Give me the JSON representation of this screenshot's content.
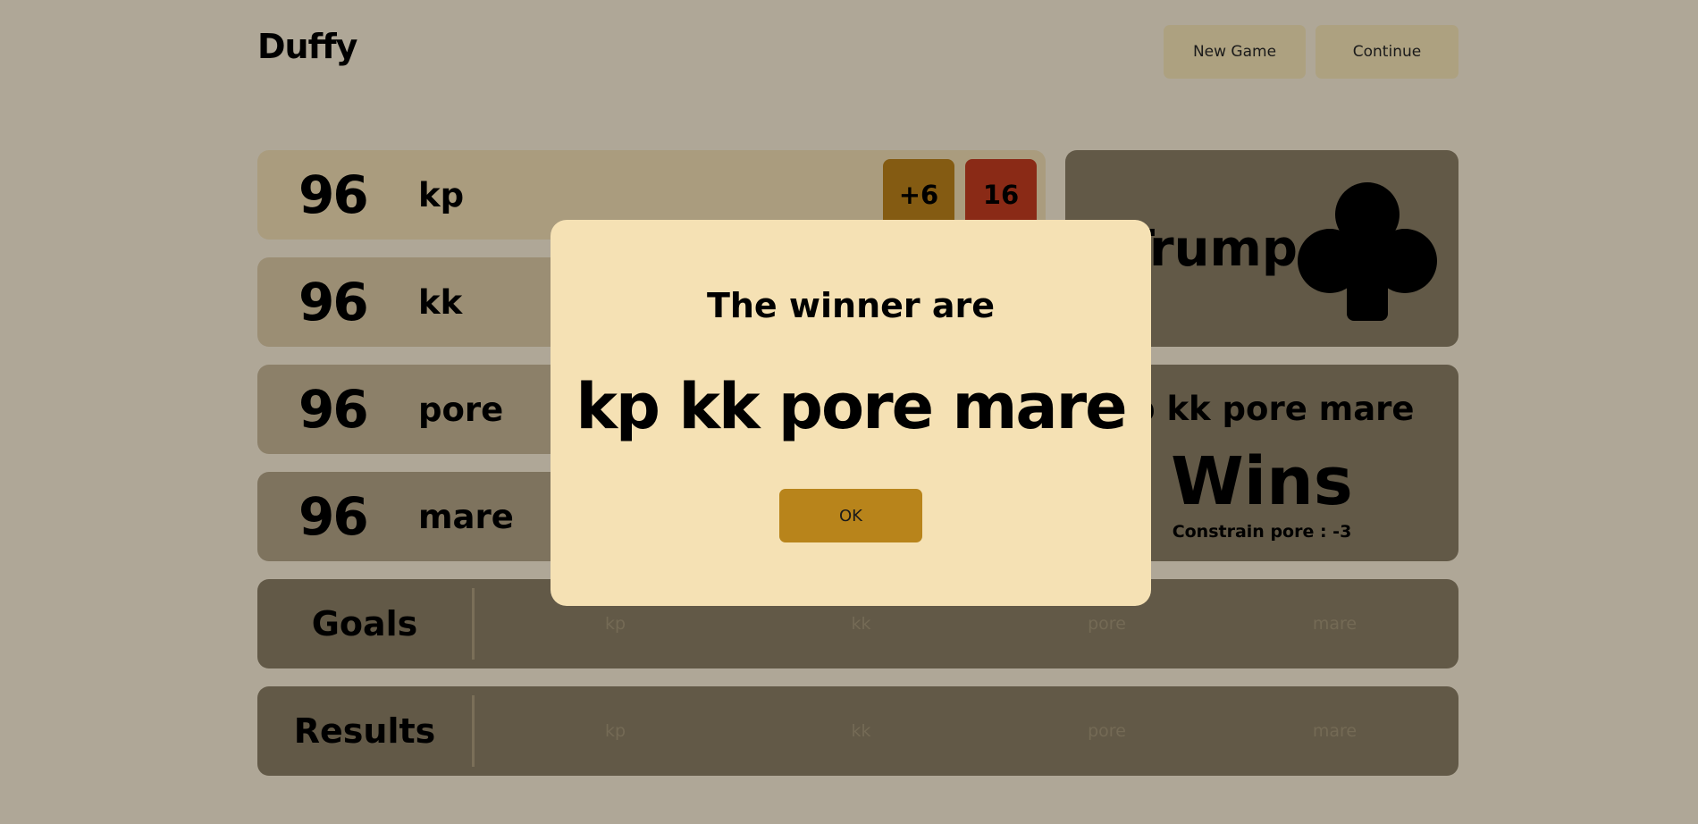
{
  "header": {
    "title": "Duffy",
    "new_game_label": "New Game",
    "continue_label": "Continue"
  },
  "players": [
    {
      "score": "96",
      "name": "kp",
      "bonus": "+6",
      "bid": "16"
    },
    {
      "score": "96",
      "name": "kk"
    },
    {
      "score": "96",
      "name": "pore"
    },
    {
      "score": "96",
      "name": "mare"
    }
  ],
  "trump": {
    "label": "Trump",
    "suit_icon": "club-icon"
  },
  "result_panel": {
    "winners": "kp kk pore mare",
    "status": "Wins",
    "constrain": "Constrain pore : -3"
  },
  "goals": {
    "label": "Goals",
    "columns": [
      "kp",
      "kk",
      "pore",
      "mare"
    ]
  },
  "results": {
    "label": "Results",
    "columns": [
      "kp",
      "kk",
      "pore",
      "mare"
    ]
  },
  "modal": {
    "title": "The winner are",
    "winners": "kp kk pore mare",
    "ok_label": "OK"
  },
  "colors": {
    "background": "#afa797",
    "panel": "#625947",
    "modal": "#f5e1b4",
    "ok_button": "#b8841b",
    "bonus_chip": "#845b12",
    "bid_chip": "#8a2a16"
  }
}
